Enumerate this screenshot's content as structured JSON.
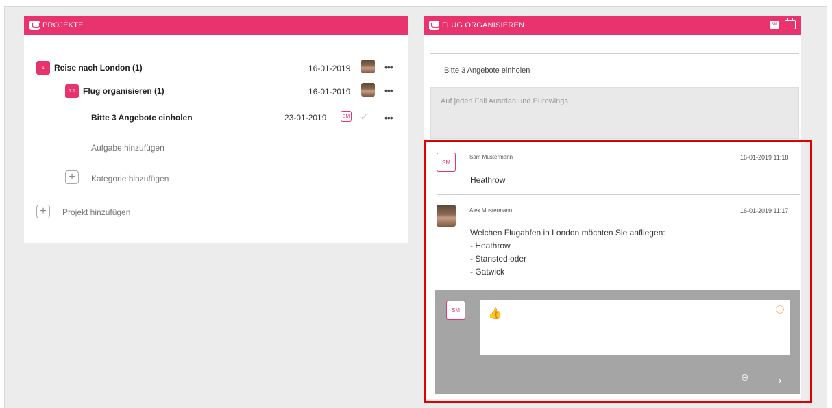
{
  "projects_panel": {
    "title": "PROJEKTE",
    "project": {
      "badge": "1",
      "name": "Reise nach London (1)",
      "date": "16-01-2019"
    },
    "category": {
      "badge": "1.1",
      "name": "Flug organisieren (1)",
      "date": "16-01-2019"
    },
    "task": {
      "name": "Bitte 3 Angebote einholen",
      "date": "23-01-2019",
      "assignee": "SM"
    },
    "more_label": "•••",
    "add_task": "Aufgabe hinzufügen",
    "add_category": "Kategorie hinzufügen",
    "add_project": "Projekt hinzufügen",
    "plus": "+"
  },
  "task_panel": {
    "title": "FLUG ORGANISIEREN",
    "header_badge": "SM",
    "task_title": "Bitte 3 Angebote einholen",
    "description": "Auf jeden Fall Austrian und Eurowings"
  },
  "comments": [
    {
      "initials": "SM",
      "author": "Sam Mustermann",
      "timestamp": "16-01-2019 11:18",
      "lines": [
        "Heathrow"
      ]
    },
    {
      "author": "Alex Mustermann",
      "timestamp": "16-01-2019 11:17",
      "lines": [
        "Welchen Flugahfen in London möchten Sie anfliegen:",
        "- Heathrow",
        "- Stansted oder",
        "- Gatwick"
      ]
    }
  ],
  "composer": {
    "initials": "SM",
    "value": "👍",
    "send_icon": "→",
    "attach_icon": "⊘"
  },
  "colors": {
    "accent": "#e8336f",
    "highlight": "#e00000",
    "background": "#ececec"
  }
}
